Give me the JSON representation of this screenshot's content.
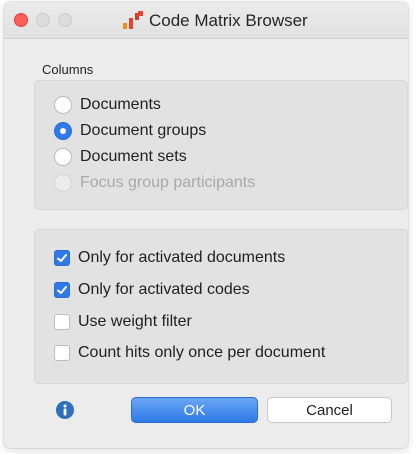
{
  "window": {
    "title": "Code Matrix Browser",
    "app_icon": "maxqda-app-icon"
  },
  "columns": {
    "label": "Columns",
    "selected": "Document groups",
    "options": [
      {
        "label": "Documents",
        "selected": false,
        "enabled": true
      },
      {
        "label": "Document groups",
        "selected": true,
        "enabled": true
      },
      {
        "label": "Document sets",
        "selected": false,
        "enabled": true
      },
      {
        "label": "Focus group participants",
        "selected": false,
        "enabled": false
      }
    ]
  },
  "options": [
    {
      "label": "Only for activated documents",
      "checked": true
    },
    {
      "label": "Only for activated codes",
      "checked": true
    },
    {
      "label": "Use weight filter",
      "checked": false
    },
    {
      "label": "Count hits only once per document",
      "checked": false
    }
  ],
  "buttons": {
    "ok": "OK",
    "cancel": "Cancel"
  },
  "icons": {
    "info": "info-icon"
  },
  "colors": {
    "accent": "#2e7ae6",
    "close": "#fc5f57",
    "info": "#2f6fbf"
  }
}
